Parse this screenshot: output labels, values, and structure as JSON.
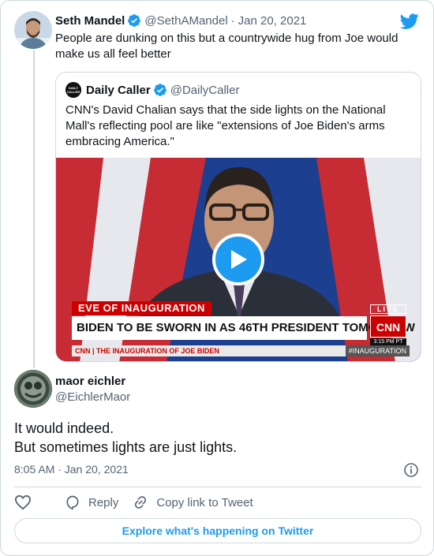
{
  "tweet": {
    "name": "Seth Mandel",
    "handle": "@SethAMandel",
    "separator": "·",
    "date": "Jan 20, 2021",
    "text": "People are dunking on this but a countrywide hug from Joe would make us all feel better"
  },
  "quoted": {
    "name": "Daily Caller",
    "handle": "@DailyCaller",
    "avatar_text": "DAILY CALLER",
    "text": "CNN's David Chalian says that the side lights on the National Mall's reflecting pool are like \"extensions of Joe Biden's arms embracing America.\"",
    "media": {
      "banner": "EVE OF INAUGURATION",
      "headline": "BIDEN TO BE SWORN IN AS 46TH PRESIDENT TOMORROW",
      "live": "LIVE",
      "network": "CNN",
      "time": "3:15 PM PT",
      "ticker": "CNN | THE INAUGURATION OF JOE BIDEN",
      "hashtag": "#INAUGURATION"
    }
  },
  "reply": {
    "name": "maor eichler",
    "handle": "@EichlerMaor",
    "line1": "It would indeed.",
    "line2": "But sometimes lights are just lights.",
    "meta": "8:05 AM · Jan 20, 2021"
  },
  "actions": {
    "reply": "Reply",
    "copy_link": "Copy link to Tweet"
  },
  "explore_label": "Explore what's happening on Twitter",
  "colors": {
    "accent": "#1d9bf0",
    "cnn_red": "#cc0000",
    "muted": "#536471"
  },
  "icons": [
    "twitter-bird-icon",
    "verified-badge-icon",
    "play-icon",
    "info-icon",
    "heart-icon",
    "reply-icon",
    "link-icon"
  ]
}
